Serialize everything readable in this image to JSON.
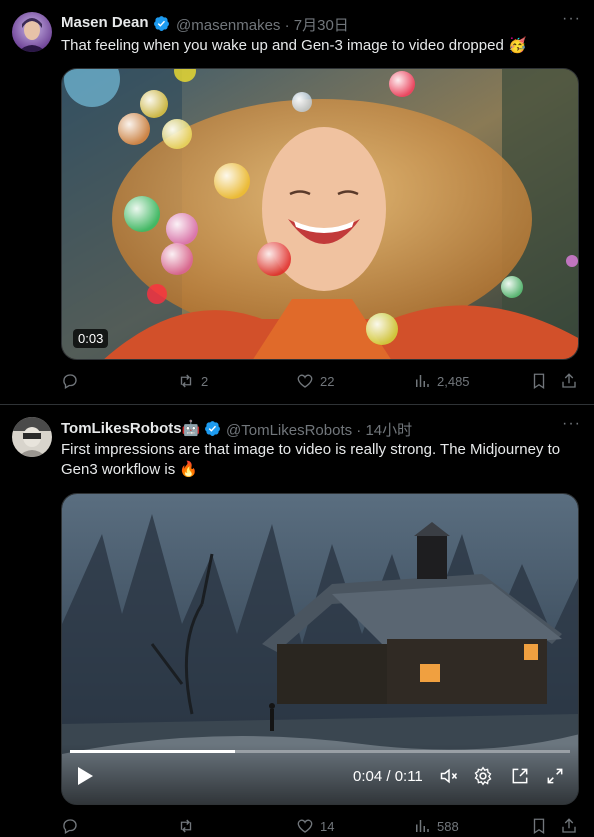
{
  "tweets": [
    {
      "author": "Masen Dean",
      "handle": "@masenmakes",
      "sep": "·",
      "date": "7月30日",
      "text": "That feeling when you wake up and Gen-3 image to video dropped 🥳",
      "media_duration": "0:03",
      "replies": "",
      "retweets": "2",
      "likes": "22",
      "views": "2,485"
    },
    {
      "author": "TomLikesRobots🤖",
      "handle": "@TomLikesRobots",
      "sep": "·",
      "date": "14小时",
      "text_line1": "First impressions are that image to video is really strong. The Midjourney to",
      "text_line2": "Gen3 workflow is 🔥",
      "player_time": "0:04 / 0:11",
      "player_progress": 0.33,
      "replies": "",
      "retweets": "",
      "likes": "14",
      "views": "588"
    }
  ],
  "colors": {
    "verified": "#1d9bf0",
    "muted": "#71767b",
    "text": "#e7e9ea",
    "border": "#2f3336"
  },
  "icons": [
    "reply-icon",
    "retweet-icon",
    "like-icon",
    "views-icon",
    "bookmark-icon",
    "share-icon",
    "play-icon",
    "mute-icon",
    "settings-icon",
    "pip-icon",
    "fullscreen-icon",
    "more-icon",
    "verified-icon"
  ]
}
